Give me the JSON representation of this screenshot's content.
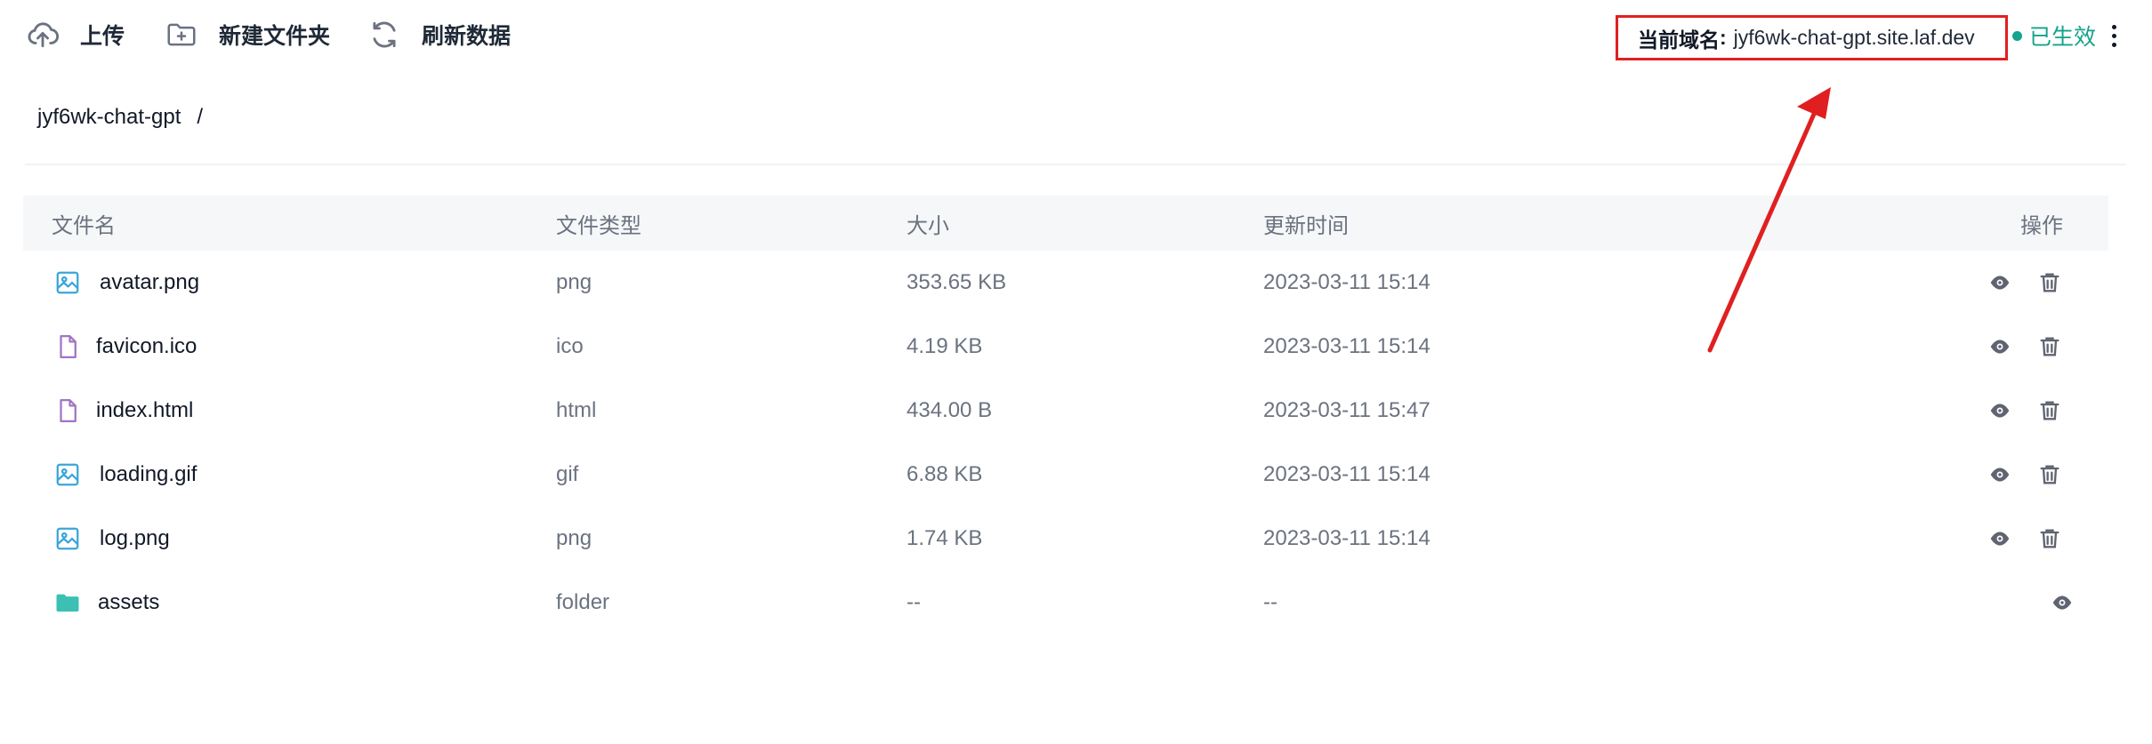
{
  "toolbar": {
    "upload_label": "上传",
    "new_folder_label": "新建文件夹",
    "refresh_label": "刷新数据",
    "upload_icon": "cloud-upload-icon",
    "new_folder_icon": "folder-plus-icon",
    "refresh_icon": "refresh-icon"
  },
  "domain": {
    "label": "当前域名",
    "separator": ":",
    "value": "jyf6wk-chat-gpt.site.laf.dev",
    "status": "已生效",
    "status_color": "#14a38b",
    "highlight_color": "#e02020"
  },
  "breadcrumb": {
    "bucket": "jyf6wk-chat-gpt",
    "separator": "/"
  },
  "table": {
    "headers": {
      "name": "文件名",
      "type": "文件类型",
      "size": "大小",
      "time": "更新时间",
      "ops": "操作"
    },
    "rows": [
      {
        "name": "avatar.png",
        "type": "png",
        "size": "353.65 KB",
        "time": "2023-03-11 15:14",
        "icon": "image-file-icon"
      },
      {
        "name": "favicon.ico",
        "type": "ico",
        "size": "4.19 KB",
        "time": "2023-03-11 15:14",
        "icon": "document-file-icon"
      },
      {
        "name": "index.html",
        "type": "html",
        "size": "434.00 B",
        "time": "2023-03-11 15:47",
        "icon": "document-file-icon"
      },
      {
        "name": "loading.gif",
        "type": "gif",
        "size": "6.88 KB",
        "time": "2023-03-11 15:14",
        "icon": "image-file-icon"
      },
      {
        "name": "log.png",
        "type": "png",
        "size": "1.74 KB",
        "time": "2023-03-11 15:14",
        "icon": "image-file-icon"
      },
      {
        "name": "assets",
        "type": "folder",
        "size": "--",
        "time": "--",
        "icon": "folder-icon"
      }
    ]
  },
  "colors": {
    "image_icon": "#3ba5d8",
    "document_icon": "#a074c4",
    "folder_icon": "#3cc0b4",
    "action_icon": "#5f6470"
  }
}
